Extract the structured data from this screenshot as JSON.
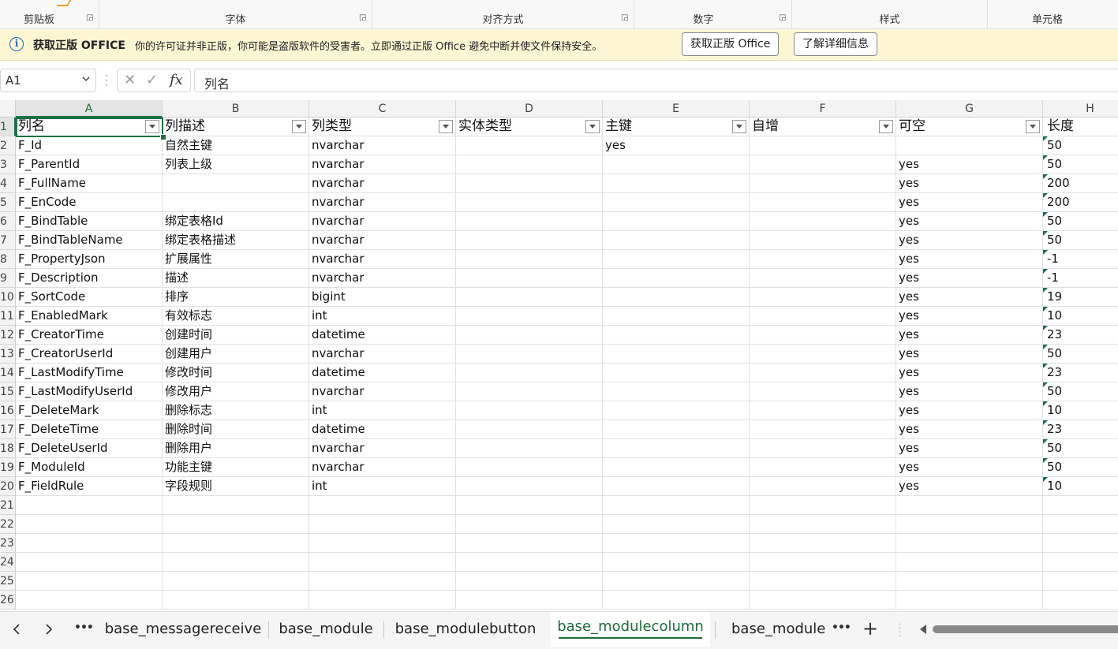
{
  "ribbon": {
    "groups": [
      {
        "label": "剪贴板",
        "launcher": true
      },
      {
        "label": "字体",
        "launcher": true
      },
      {
        "label": "对齐方式",
        "launcher": true
      },
      {
        "label": "数字",
        "launcher": true
      },
      {
        "label": "样式",
        "launcher": false
      },
      {
        "label": "单元格",
        "launcher": false
      }
    ]
  },
  "message_bar": {
    "title": "获取正版 OFFICE",
    "text": "你的许可证并非正版，你可能是盗版软件的受害者。立即通过正版 Office 避免中断并使文件保持安全。",
    "button_primary": "获取正版 Office",
    "button_secondary": "了解详细信息"
  },
  "formula_bar": {
    "name_box": "A1",
    "formula": "列名"
  },
  "grid": {
    "columns": [
      "A",
      "B",
      "C",
      "D",
      "E",
      "F",
      "G",
      "H"
    ],
    "selected_cell": "A1",
    "rows": [
      [
        "列名",
        "列描述",
        "列类型",
        "实体类型",
        "主键",
        "自增",
        "可空",
        "长度"
      ],
      [
        "F_Id",
        "自然主键",
        "nvarchar",
        "",
        "yes",
        "",
        "",
        "50"
      ],
      [
        "F_ParentId",
        "列表上级",
        "nvarchar",
        "",
        "",
        "",
        "yes",
        "50"
      ],
      [
        "F_FullName",
        "",
        "nvarchar",
        "",
        "",
        "",
        "yes",
        "200"
      ],
      [
        "F_EnCode",
        "",
        "nvarchar",
        "",
        "",
        "",
        "yes",
        "200"
      ],
      [
        "F_BindTable",
        "绑定表格Id",
        "nvarchar",
        "",
        "",
        "",
        "yes",
        "50"
      ],
      [
        "F_BindTableName",
        "绑定表格描述",
        "nvarchar",
        "",
        "",
        "",
        "yes",
        "50"
      ],
      [
        "F_PropertyJson",
        "扩展属性",
        "nvarchar",
        "",
        "",
        "",
        "yes",
        "-1"
      ],
      [
        "F_Description",
        "描述",
        "nvarchar",
        "",
        "",
        "",
        "yes",
        "-1"
      ],
      [
        "F_SortCode",
        "排序",
        "bigint",
        "",
        "",
        "",
        "yes",
        "19"
      ],
      [
        "F_EnabledMark",
        "有效标志",
        "int",
        "",
        "",
        "",
        "yes",
        "10"
      ],
      [
        "F_CreatorTime",
        "创建时间",
        "datetime",
        "",
        "",
        "",
        "yes",
        "23"
      ],
      [
        "F_CreatorUserId",
        "创建用户",
        "nvarchar",
        "",
        "",
        "",
        "yes",
        "50"
      ],
      [
        "F_LastModifyTime",
        "修改时间",
        "datetime",
        "",
        "",
        "",
        "yes",
        "23"
      ],
      [
        "F_LastModifyUserId",
        "修改用户",
        "nvarchar",
        "",
        "",
        "",
        "yes",
        "50"
      ],
      [
        "F_DeleteMark",
        "删除标志",
        "int",
        "",
        "",
        "",
        "yes",
        "10"
      ],
      [
        "F_DeleteTime",
        "删除时间",
        "datetime",
        "",
        "",
        "",
        "yes",
        "23"
      ],
      [
        "F_DeleteUserId",
        "删除用户",
        "nvarchar",
        "",
        "",
        "",
        "yes",
        "50"
      ],
      [
        "F_ModuleId",
        "功能主键",
        "nvarchar",
        "",
        "",
        "",
        "yes",
        "50"
      ],
      [
        "F_FieldRule",
        "字段规则",
        "int",
        "",
        "",
        "",
        "yes",
        "10"
      ],
      [
        "",
        "",
        "",
        "",
        "",
        "",
        "",
        ""
      ],
      [
        "",
        "",
        "",
        "",
        "",
        "",
        "",
        ""
      ],
      [
        "",
        "",
        "",
        "",
        "",
        "",
        "",
        ""
      ],
      [
        "",
        "",
        "",
        "",
        "",
        "",
        "",
        ""
      ],
      [
        "",
        "",
        "",
        "",
        "",
        "",
        "",
        ""
      ],
      [
        "",
        "",
        "",
        "",
        "",
        "",
        "",
        ""
      ]
    ]
  },
  "sheet_tabs": {
    "tabs": [
      "base_messagereceive",
      "base_module",
      "base_modulebutton",
      "base_modulecolumn",
      "base_modulec"
    ],
    "active": "base_modulecolumn"
  },
  "colors": {
    "excel_green": "#1e7145",
    "message_bar_bg": "#fdf6d3",
    "info_blue": "#2266bb"
  }
}
